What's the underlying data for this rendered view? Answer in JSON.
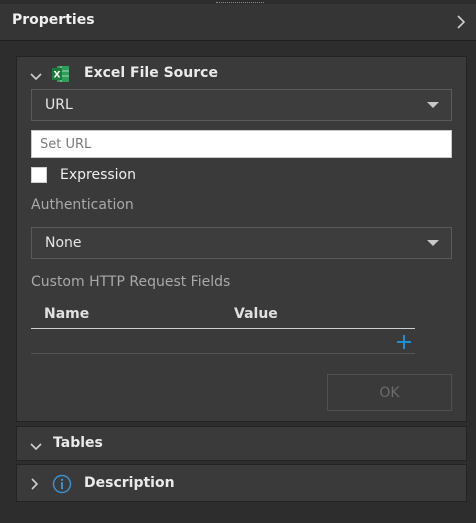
{
  "header": {
    "title": "Properties"
  },
  "excel_section": {
    "title": "Excel File Source",
    "source_type": {
      "selected": "URL"
    },
    "url_input": {
      "value": "",
      "placeholder": "Set URL"
    },
    "expression": {
      "label": "Expression",
      "checked": false
    },
    "authentication": {
      "label": "Authentication",
      "selected": "None"
    },
    "custom_fields": {
      "label": "Custom HTTP Request Fields",
      "columns": [
        "Name",
        "Value"
      ],
      "rows": []
    },
    "ok_label": "OK"
  },
  "tables_section": {
    "title": "Tables"
  },
  "description_section": {
    "title": "Description"
  },
  "colors": {
    "accent": "#1e8fd6",
    "excel_green": "#1e7a3c",
    "info_blue": "#3a8fd0"
  }
}
